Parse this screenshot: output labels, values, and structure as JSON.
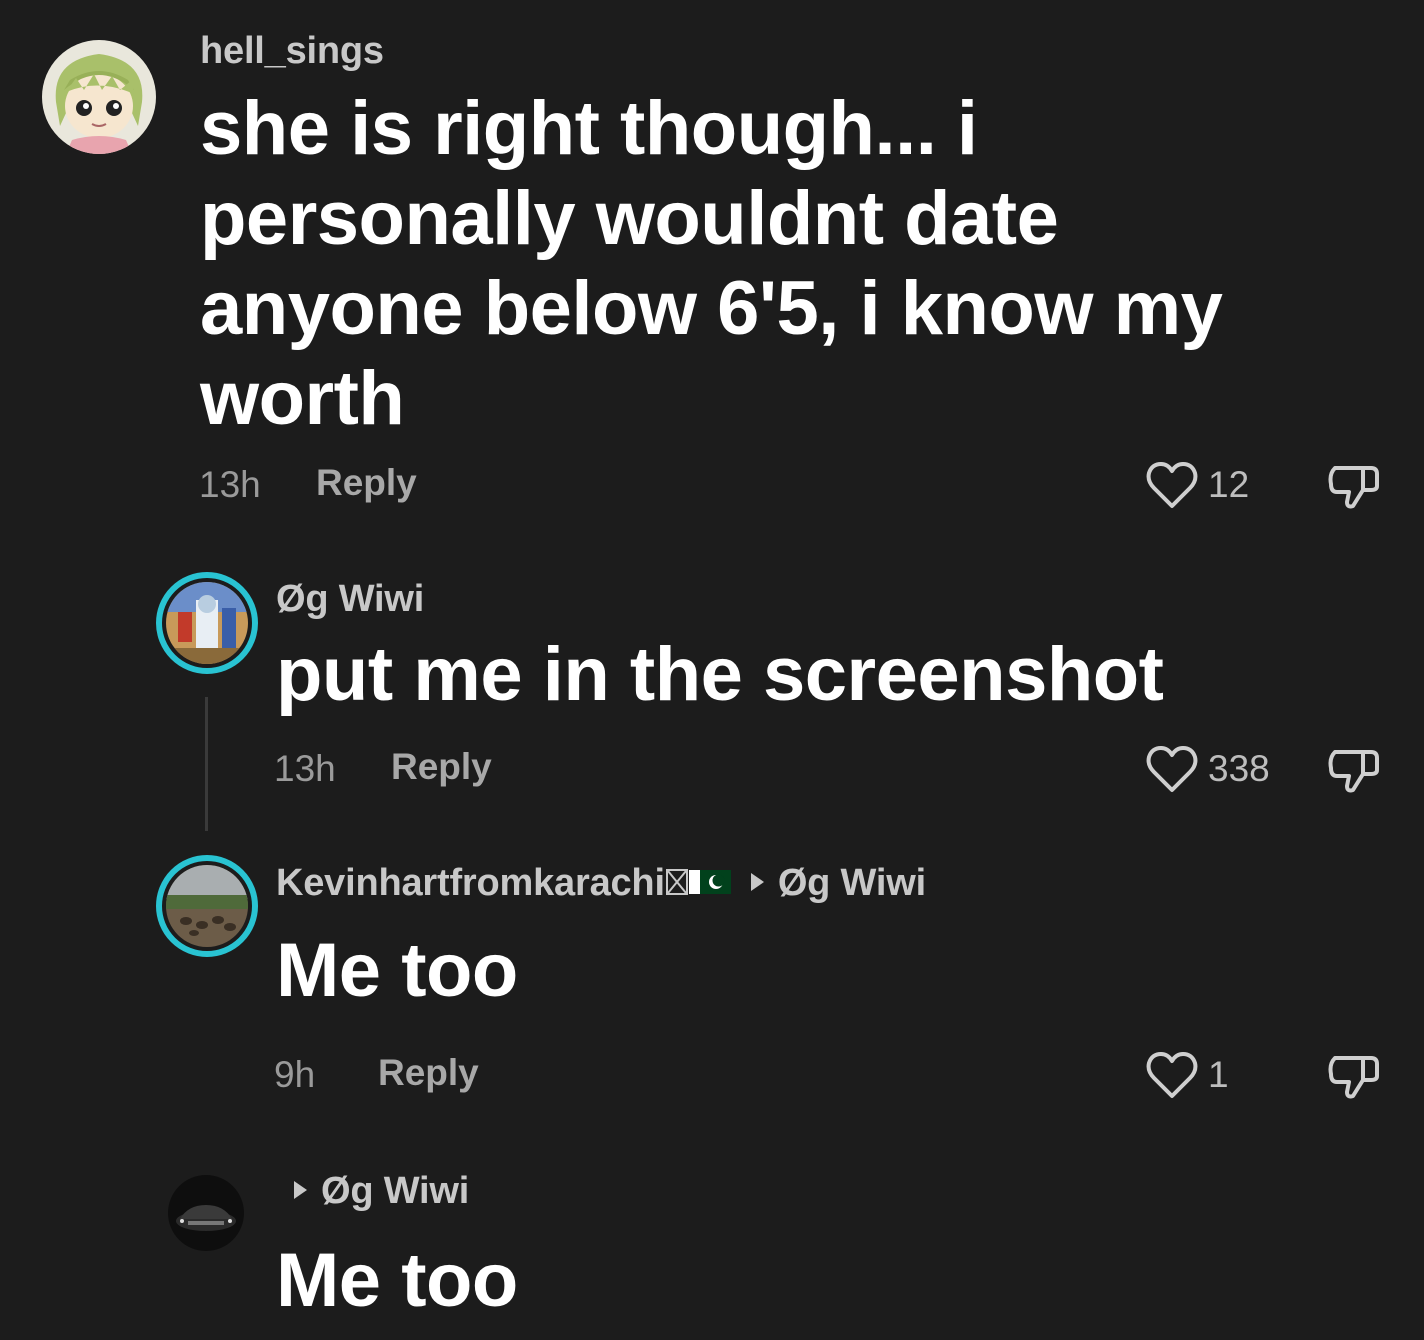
{
  "comments": [
    {
      "username": "hell_sings",
      "text_lines": [
        "she is right though... i",
        "personally wouldnt date",
        "anyone below 6'5, i know my",
        "worth"
      ],
      "time": "13h",
      "reply_label": "Reply",
      "likes": "12"
    },
    {
      "username": "Øg Wiwi",
      "text": "put me in the screenshot",
      "time": "13h",
      "reply_label": "Reply",
      "likes": "338"
    },
    {
      "username": "Kevinhartfromkarachi",
      "reply_to": "Øg Wiwi",
      "text": "Me too",
      "time": "9h",
      "reply_label": "Reply",
      "likes": "1"
    },
    {
      "reply_to": "Øg Wiwi",
      "text": "Me too"
    }
  ],
  "icons": {
    "like": "heart-outline-icon",
    "dislike": "thumbs-down-outline-icon",
    "reply_arrow": "right-triangle-icon",
    "flags": [
      "box-x-icon",
      "pakistan-flag-icon"
    ]
  },
  "colors": {
    "background": "#1c1c1c",
    "text_primary": "#ffffff",
    "text_secondary": "#9a9a9a",
    "story_ring": "#29c3d2"
  }
}
